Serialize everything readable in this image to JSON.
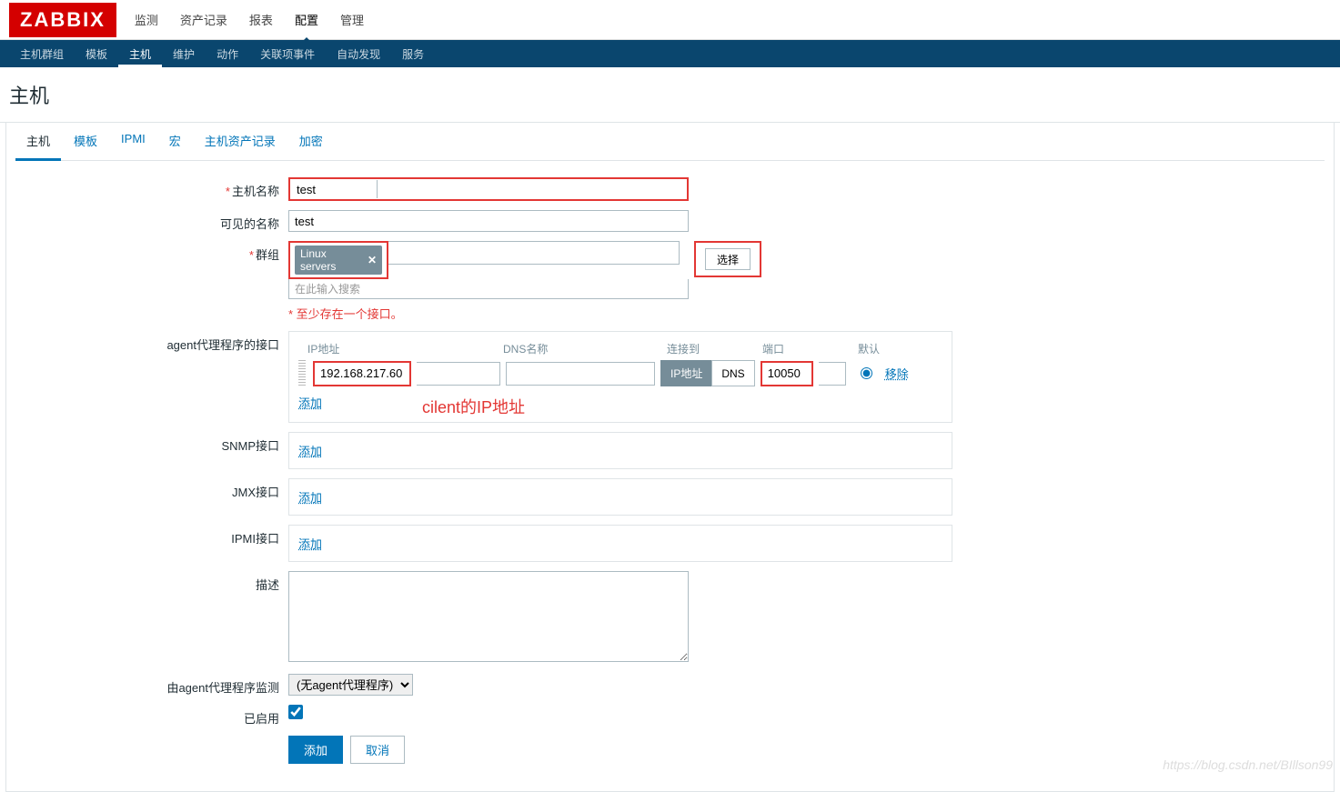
{
  "logo": "ZABBIX",
  "topnav": [
    "监测",
    "资产记录",
    "报表",
    "配置",
    "管理"
  ],
  "topnav_active": 3,
  "subnav": [
    "主机群组",
    "模板",
    "主机",
    "维护",
    "动作",
    "关联项事件",
    "自动发现",
    "服务"
  ],
  "subnav_active": 2,
  "page_title": "主机",
  "tabs": [
    "主机",
    "模板",
    "IPMI",
    "宏",
    "主机资产记录",
    "加密"
  ],
  "tabs_active": 0,
  "labels": {
    "hostname": "主机名称",
    "visiblename": "可见的名称",
    "groups": "群组",
    "agent_iface": "agent代理程序的接口",
    "snmp_iface": "SNMP接口",
    "jmx_iface": "JMX接口",
    "ipmi_iface": "IPMI接口",
    "description": "描述",
    "proxy": "由agent代理程序监测",
    "enabled": "已启用"
  },
  "values": {
    "hostname": "test",
    "visiblename": "test",
    "group_tag": "Linux servers",
    "search_hint": "在此输入搜索",
    "ip": "192.168.217.60",
    "dns": "",
    "port": "10050",
    "proxy_option": "(无agent代理程序)"
  },
  "buttons": {
    "select": "选择",
    "add": "添加",
    "remove": "移除",
    "cancel": "取消",
    "ip": "IP地址",
    "dns": "DNS"
  },
  "headers": {
    "ip": "IP地址",
    "dns": "DNS名称",
    "conn": "连接到",
    "port": "端口",
    "default": "默认"
  },
  "error_msg": "至少存在一个接口。",
  "annotation": "cilent的IP地址",
  "watermark": "https://blog.csdn.net/BIllson99"
}
